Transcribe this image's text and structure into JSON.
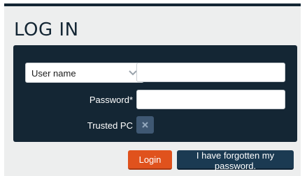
{
  "title": "LOG IN",
  "form": {
    "username_select": {
      "selected": "User name"
    },
    "username_value": "",
    "password_label": "Password*",
    "password_value": "",
    "trusted_label": "Trusted PC",
    "trusted_checked": false
  },
  "actions": {
    "login_label": "Login",
    "forgot_label": "I have forgotten my password."
  },
  "colors": {
    "dark_navy": "#142634",
    "login_orange": "#e0521d",
    "checkbox_blue": "#3f5873"
  },
  "icons": {
    "select": "chevron-down-icon",
    "checkbox": "close-icon"
  }
}
